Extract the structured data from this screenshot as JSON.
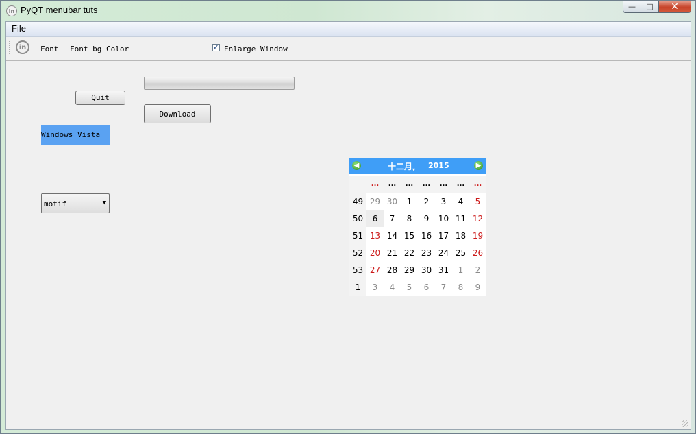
{
  "window": {
    "title": "PyQT menubar tuts",
    "app_icon": "in",
    "controls": {
      "minimize": "—",
      "maximize": "□",
      "close": "✕"
    }
  },
  "menubar": {
    "items": [
      {
        "label": "File"
      }
    ]
  },
  "toolbar": {
    "icon": "in",
    "font_label": "Font",
    "font_bg_label": "Font bg Color",
    "enlarge_label": "Enlarge Window",
    "enlarge_checked": true,
    "check_mark": "✓"
  },
  "main": {
    "quit_label": "Quit",
    "download_label": "Download",
    "progress_value": 0,
    "style_label": "Windows Vista",
    "style_combo": {
      "selected": "motif",
      "arrow": "▼"
    }
  },
  "calendar": {
    "month": "十二月",
    "year": "2015",
    "prev": "◀",
    "next": "▶",
    "weekday_headers": [
      "...",
      "...",
      "...",
      "...",
      "...",
      "...",
      "..."
    ],
    "weekday_header_red": [
      true,
      false,
      false,
      false,
      false,
      false,
      true
    ],
    "weeks": [
      {
        "week": "49",
        "days": [
          {
            "d": "29",
            "dim": true,
            "red": true
          },
          {
            "d": "30",
            "dim": true
          },
          {
            "d": "1"
          },
          {
            "d": "2"
          },
          {
            "d": "3"
          },
          {
            "d": "4"
          },
          {
            "d": "5",
            "red": true
          }
        ]
      },
      {
        "week": "50",
        "days": [
          {
            "d": "6",
            "red": false,
            "sel": true
          },
          {
            "d": "7"
          },
          {
            "d": "8"
          },
          {
            "d": "9"
          },
          {
            "d": "10"
          },
          {
            "d": "11"
          },
          {
            "d": "12",
            "red": true
          }
        ]
      },
      {
        "week": "51",
        "days": [
          {
            "d": "13",
            "red": true
          },
          {
            "d": "14"
          },
          {
            "d": "15"
          },
          {
            "d": "16"
          },
          {
            "d": "17"
          },
          {
            "d": "18"
          },
          {
            "d": "19",
            "red": true
          }
        ]
      },
      {
        "week": "52",
        "days": [
          {
            "d": "20",
            "red": true
          },
          {
            "d": "21"
          },
          {
            "d": "22"
          },
          {
            "d": "23"
          },
          {
            "d": "24"
          },
          {
            "d": "25"
          },
          {
            "d": "26",
            "red": true
          }
        ]
      },
      {
        "week": "53",
        "days": [
          {
            "d": "27",
            "red": true
          },
          {
            "d": "28"
          },
          {
            "d": "29"
          },
          {
            "d": "30"
          },
          {
            "d": "31"
          },
          {
            "d": "1",
            "dim": true
          },
          {
            "d": "2",
            "dim": true
          }
        ]
      },
      {
        "week": "1",
        "days": [
          {
            "d": "3",
            "dim": true
          },
          {
            "d": "4",
            "dim": true
          },
          {
            "d": "5",
            "dim": true
          },
          {
            "d": "6",
            "dim": true
          },
          {
            "d": "7",
            "dim": true
          },
          {
            "d": "8",
            "dim": true
          },
          {
            "d": "9",
            "dim": true
          }
        ]
      }
    ]
  },
  "colors": {
    "calendar_header": "#3f9ef7",
    "style_label_bg": "#5aa2f2",
    "weekend_red": "#cc1a1a"
  }
}
